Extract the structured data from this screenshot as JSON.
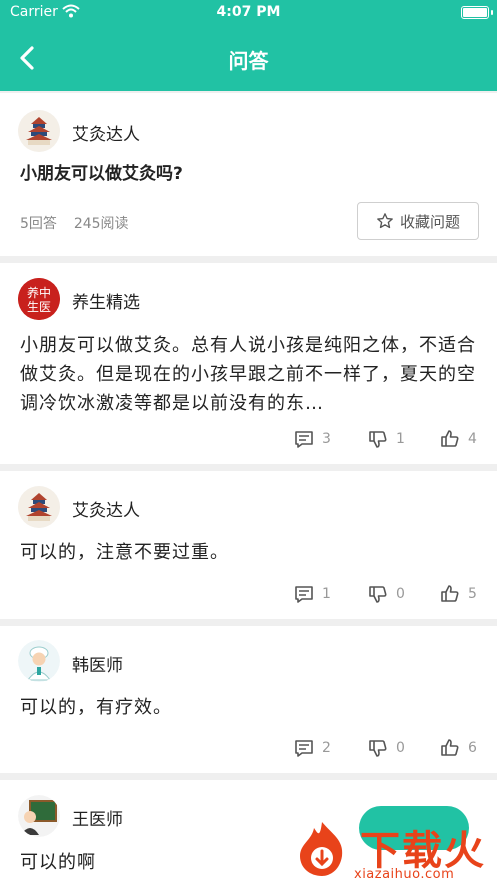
{
  "status_bar": {
    "carrier": "Carrier",
    "time": "4:07 PM"
  },
  "nav": {
    "title": "问答"
  },
  "question": {
    "user": "艾灸达人",
    "title": "小朋友可以做艾灸吗?",
    "answers_count": "5回答",
    "reads_count": "245阅读",
    "favorite_label": "收藏问题"
  },
  "answers": [
    {
      "user": "养生精选",
      "avatar_text": "养中生医",
      "text": "小朋友可以做艾灸。总有人说小孩是纯阳之体，不适合做艾灸。但是现在的小孩早跟之前不一样了，夏天的空调冷饮冰激凌等都是以前没有的东…",
      "comments": "3",
      "dislikes": "1",
      "likes": "4"
    },
    {
      "user": "艾灸达人",
      "text": "可以的，注意不要过重。",
      "comments": "1",
      "dislikes": "0",
      "likes": "5"
    },
    {
      "user": "韩医师",
      "text": "可以的，有疗效。",
      "comments": "2",
      "dislikes": "0",
      "likes": "6"
    },
    {
      "user": "王医师",
      "text": "可以的啊"
    }
  ],
  "watermark": {
    "brand": "下载火",
    "url": "xiazaihuo.com"
  },
  "colors": {
    "brand_green": "#21c2a4",
    "watermark_red": "#e8431a"
  }
}
